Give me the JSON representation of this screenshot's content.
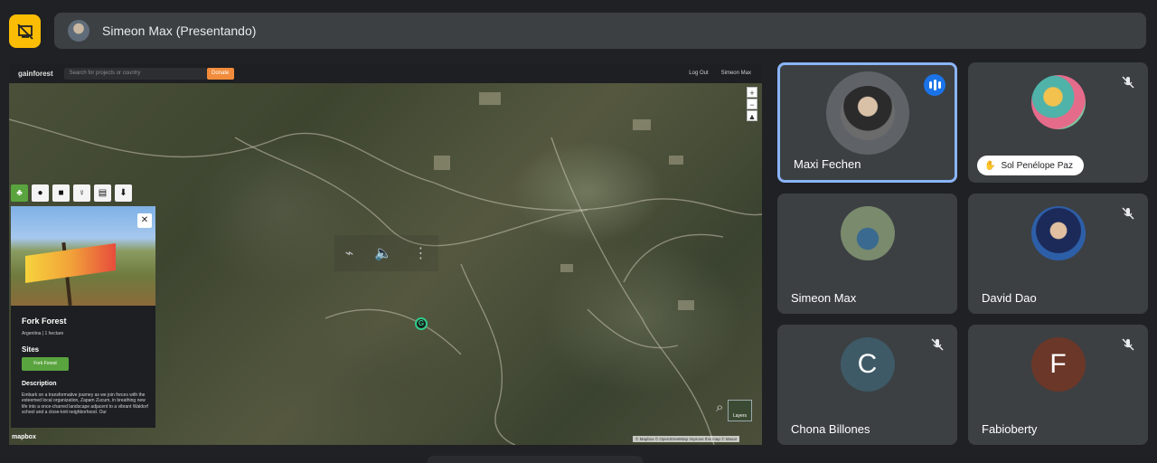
{
  "presenter": {
    "label": "Simeon Max (Presentando)"
  },
  "shared_app": {
    "logo": "gainforest",
    "search_placeholder": "Search for projects or country",
    "donate": "Donate",
    "logout": "Log Out",
    "user": "Simeon Max",
    "zoom_in": "+",
    "zoom_out": "−",
    "compass": "▲",
    "layers_label": "Layers",
    "attribution": "© Mapbox © OpenStreetMap  Improve this map © Maxar",
    "mapbox": "mapbox",
    "panel": {
      "close": "✕",
      "title": "Fork Forest",
      "meta": "Argentina  |  1 hectare",
      "sites_label": "Sites",
      "site_button": "Fork Forest",
      "description_title": "Description",
      "description": "Embark on a transformative journey as we join forces with the esteemed local organization, Zapam Zucum, in breathing new life into a once-charred landscape adjacent to a vibrant Waldorf school and a close-knit neighborhood. Our"
    },
    "tools": [
      "tree-icon",
      "paw-icon",
      "book-icon",
      "person-icon",
      "chat-icon",
      "download-icon"
    ]
  },
  "participants": [
    {
      "name": "Maxi Fechen",
      "speaking": true
    },
    {
      "name": "Sol Penélope Paz",
      "hand_raised": true,
      "muted": true
    },
    {
      "name": "Simeon Max"
    },
    {
      "name": "David Dao",
      "muted": true
    },
    {
      "name": "Chona Billones",
      "initial": "C",
      "muted": true
    },
    {
      "name": "Fabioberty",
      "initial": "F",
      "muted": true
    }
  ],
  "colors": {
    "accent": "#8ab4f8",
    "stop_share": "#fbbc04",
    "site_green": "#5aa43f",
    "donate": "#f28c3c"
  }
}
